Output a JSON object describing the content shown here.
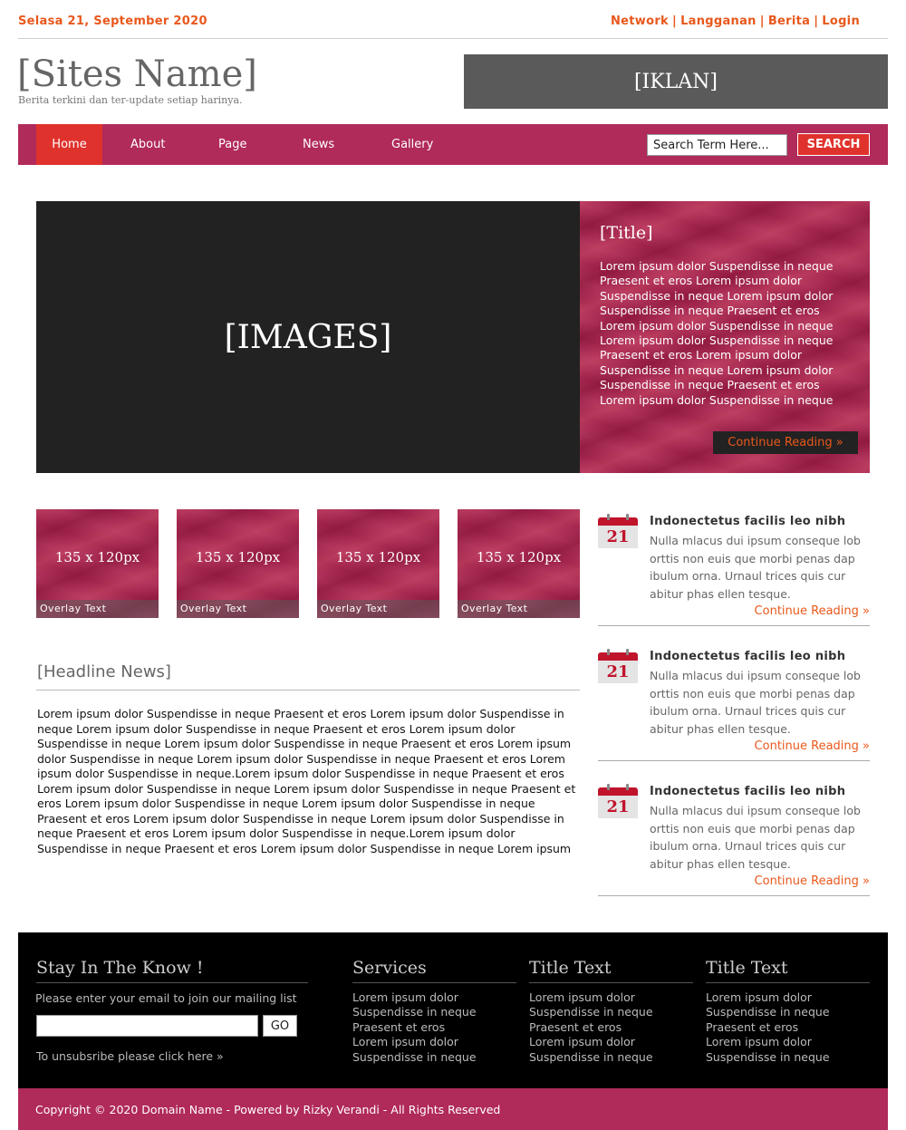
{
  "topbar": {
    "date": "Selasa 21, September 2020",
    "links": [
      "Network",
      "Langganan",
      "Berita",
      "Login"
    ]
  },
  "header": {
    "site_name": "[Sites Name]",
    "tagline": "Berita terkini dan ter-update setiap harinya.",
    "ad_label": "[IKLAN]"
  },
  "nav": {
    "items": [
      "Home",
      "About",
      "Page",
      "News",
      "Gallery"
    ],
    "active": "Home",
    "search_placeholder": "Search Term Here...",
    "search_button": "SEARCH"
  },
  "feature": {
    "image_label": "[IMAGES]",
    "title": "[Title]",
    "body": "Lorem ipsum dolor Suspendisse in neque Praesent et eros Lorem ipsum dolor Suspendisse in neque Lorem ipsum dolor Suspendisse in neque Praesent et eros Lorem ipsum dolor Suspendisse in neque Lorem ipsum dolor Suspendisse in neque Praesent et eros Lorem ipsum dolor Suspendisse in neque Lorem ipsum dolor Suspendisse in neque Praesent et eros Lorem ipsum dolor Suspendisse in neque",
    "button": "Continue Reading »"
  },
  "thumbs": [
    {
      "size": "135 x 120px",
      "overlay": "Overlay Text"
    },
    {
      "size": "135 x 120px",
      "overlay": "Overlay Text"
    },
    {
      "size": "135 x 120px",
      "overlay": "Overlay Text"
    },
    {
      "size": "135 x 120px",
      "overlay": "Overlay Text"
    }
  ],
  "headline": {
    "title": "[Headline News]",
    "body": "Lorem ipsum dolor Suspendisse in neque Praesent et eros Lorem ipsum dolor Suspendisse in neque Lorem ipsum dolor Suspendisse in neque Praesent et eros Lorem ipsum dolor Suspendisse in neque Lorem ipsum dolor Suspendisse in neque Praesent et eros Lorem ipsum dolor Suspendisse in neque Lorem ipsum dolor Suspendisse in neque Praesent et eros Lorem ipsum dolor Suspendisse in neque.Lorem ipsum dolor Suspendisse in neque Praesent et eros Lorem ipsum dolor Suspendisse in neque Lorem ipsum dolor Suspendisse in neque Praesent et eros Lorem ipsum dolor Suspendisse in neque Lorem ipsum dolor Suspendisse in neque Praesent et eros Lorem ipsum dolor Suspendisse in neque Lorem ipsum dolor Suspendisse in neque Praesent et eros Lorem ipsum dolor Suspendisse in neque.Lorem ipsum dolor Suspendisse in neque Praesent et eros Lorem ipsum dolor Suspendisse in neque Lorem ipsum"
  },
  "news": [
    {
      "day": "21",
      "title": "Indonectetus facilis leo nibh",
      "body": "Nulla mlacus dui ipsum conseque lob orttis non euis que morbi penas dap ibulum orna. Urnaul trices quis cur abitur phas ellen tesque.",
      "more": "Continue Reading »"
    },
    {
      "day": "21",
      "title": "Indonectetus facilis leo nibh",
      "body": "Nulla mlacus dui ipsum conseque lob orttis non euis que morbi penas dap ibulum orna. Urnaul trices quis cur abitur phas ellen tesque.",
      "more": "Continue Reading »"
    },
    {
      "day": "21",
      "title": "Indonectetus facilis leo nibh",
      "body": "Nulla mlacus dui ipsum conseque lob orttis non euis que morbi penas dap ibulum orna. Urnaul trices quis cur abitur phas ellen tesque.",
      "more": "Continue Reading »"
    }
  ],
  "footer": {
    "newsletter_title": "Stay In The Know !",
    "newsletter_text": "Please enter your email to join our mailing list",
    "go_button": "GO",
    "unsubscribe": "To unsubsribe please click here »",
    "columns": [
      {
        "title": "Services",
        "items": [
          "Lorem ipsum dolor",
          "Suspendisse in neque",
          "Praesent et eros",
          "Lorem ipsum dolor",
          "Suspendisse in neque"
        ]
      },
      {
        "title": "Title Text",
        "items": [
          "Lorem ipsum dolor",
          "Suspendisse in neque",
          "Praesent et eros",
          "Lorem ipsum dolor",
          "Suspendisse in neque"
        ]
      },
      {
        "title": "Title Text",
        "items": [
          "Lorem ipsum dolor",
          "Suspendisse in neque",
          "Praesent et eros",
          "Lorem ipsum dolor",
          "Suspendisse in neque"
        ]
      }
    ]
  },
  "copyright": "Copyright © 2020 Domain Name - Powered by Rizky Verandi - All Rights Reserved",
  "colors": {
    "accent_orange": "#e8581c",
    "nav_magenta": "#b02a5a",
    "active_red": "#e0322c",
    "dark": "#222222",
    "footer_black": "#000000"
  }
}
